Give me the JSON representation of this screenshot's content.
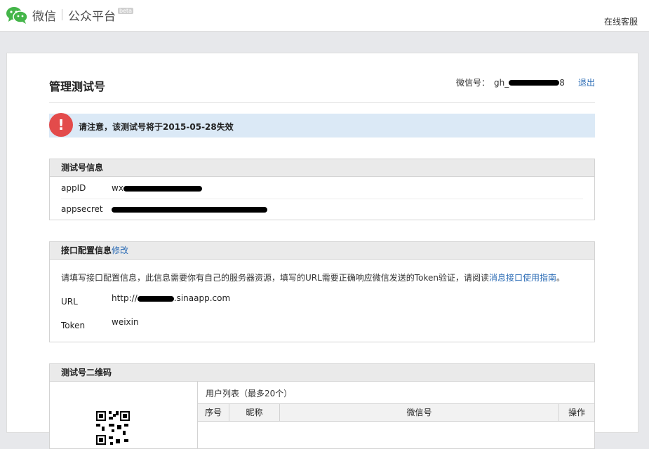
{
  "header": {
    "brand": "微信",
    "product": "公众平台",
    "beta": "beta",
    "support_link": "在线客服"
  },
  "page": {
    "title": "管理测试号",
    "account_label": "微信号：",
    "account_value_prefix": "gh_",
    "account_value_suffix": "8",
    "logout": "退出"
  },
  "notice": {
    "icon": "!",
    "text": "请注意，该测试号将于2015-05-28失效"
  },
  "test_info": {
    "heading": "测试号信息",
    "appid_label": "appID",
    "appid_value_prefix": "wx",
    "appsecret_label": "appsecret"
  },
  "interface": {
    "heading": "接口配置信息",
    "edit": "修改",
    "desc_prefix": "请填写接口配置信息，此信息需要你有自己的服务器资源，填写的URL需要正确响应微信发送的Token验证，请阅读",
    "desc_link": "消息接口使用指南",
    "desc_suffix": "。",
    "url_label": "URL",
    "url_value_prefix": "http://",
    "url_value_suffix": ".sinaapp.com",
    "token_label": "Token",
    "token_value": "weixin"
  },
  "qrcode": {
    "heading": "测试号二维码",
    "user_list": "用户列表（最多20个）",
    "columns": [
      "序号",
      "昵称",
      "微信号",
      "操作"
    ]
  },
  "colors": {
    "link": "#2a6bb5",
    "notice_bg": "#dbe9f6",
    "alert_red": "#e34b4b",
    "wechat_green": "#44b549"
  }
}
